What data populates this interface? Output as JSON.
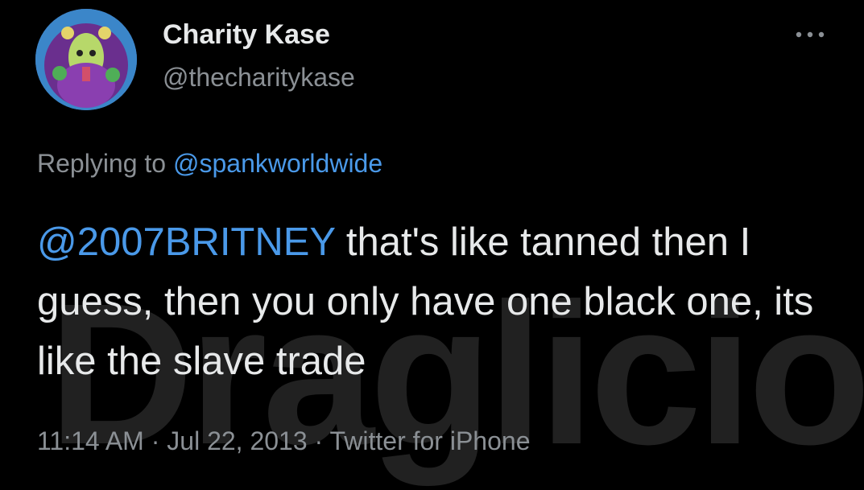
{
  "author": {
    "display_name": "Charity Kase",
    "handle": "@thecharitykase"
  },
  "reply": {
    "prefix": "Replying to ",
    "to": "@spankworldwide"
  },
  "tweet": {
    "mention": "@2007BRITNEY",
    "text": " that's like tanned then I guess, then you only have one black one, its like the slave trade"
  },
  "meta": {
    "time": "11:14 AM",
    "sep1": " · ",
    "date": "Jul 22, 2013",
    "sep2": " · ",
    "source": "Twitter for iPhone"
  },
  "watermark": "Draglicious",
  "icons": {
    "more": "more-horizontal-icon"
  },
  "colors": {
    "background": "#000000",
    "text": "#e7e9ea",
    "secondary": "#8b9095",
    "link": "#4a99e9"
  }
}
